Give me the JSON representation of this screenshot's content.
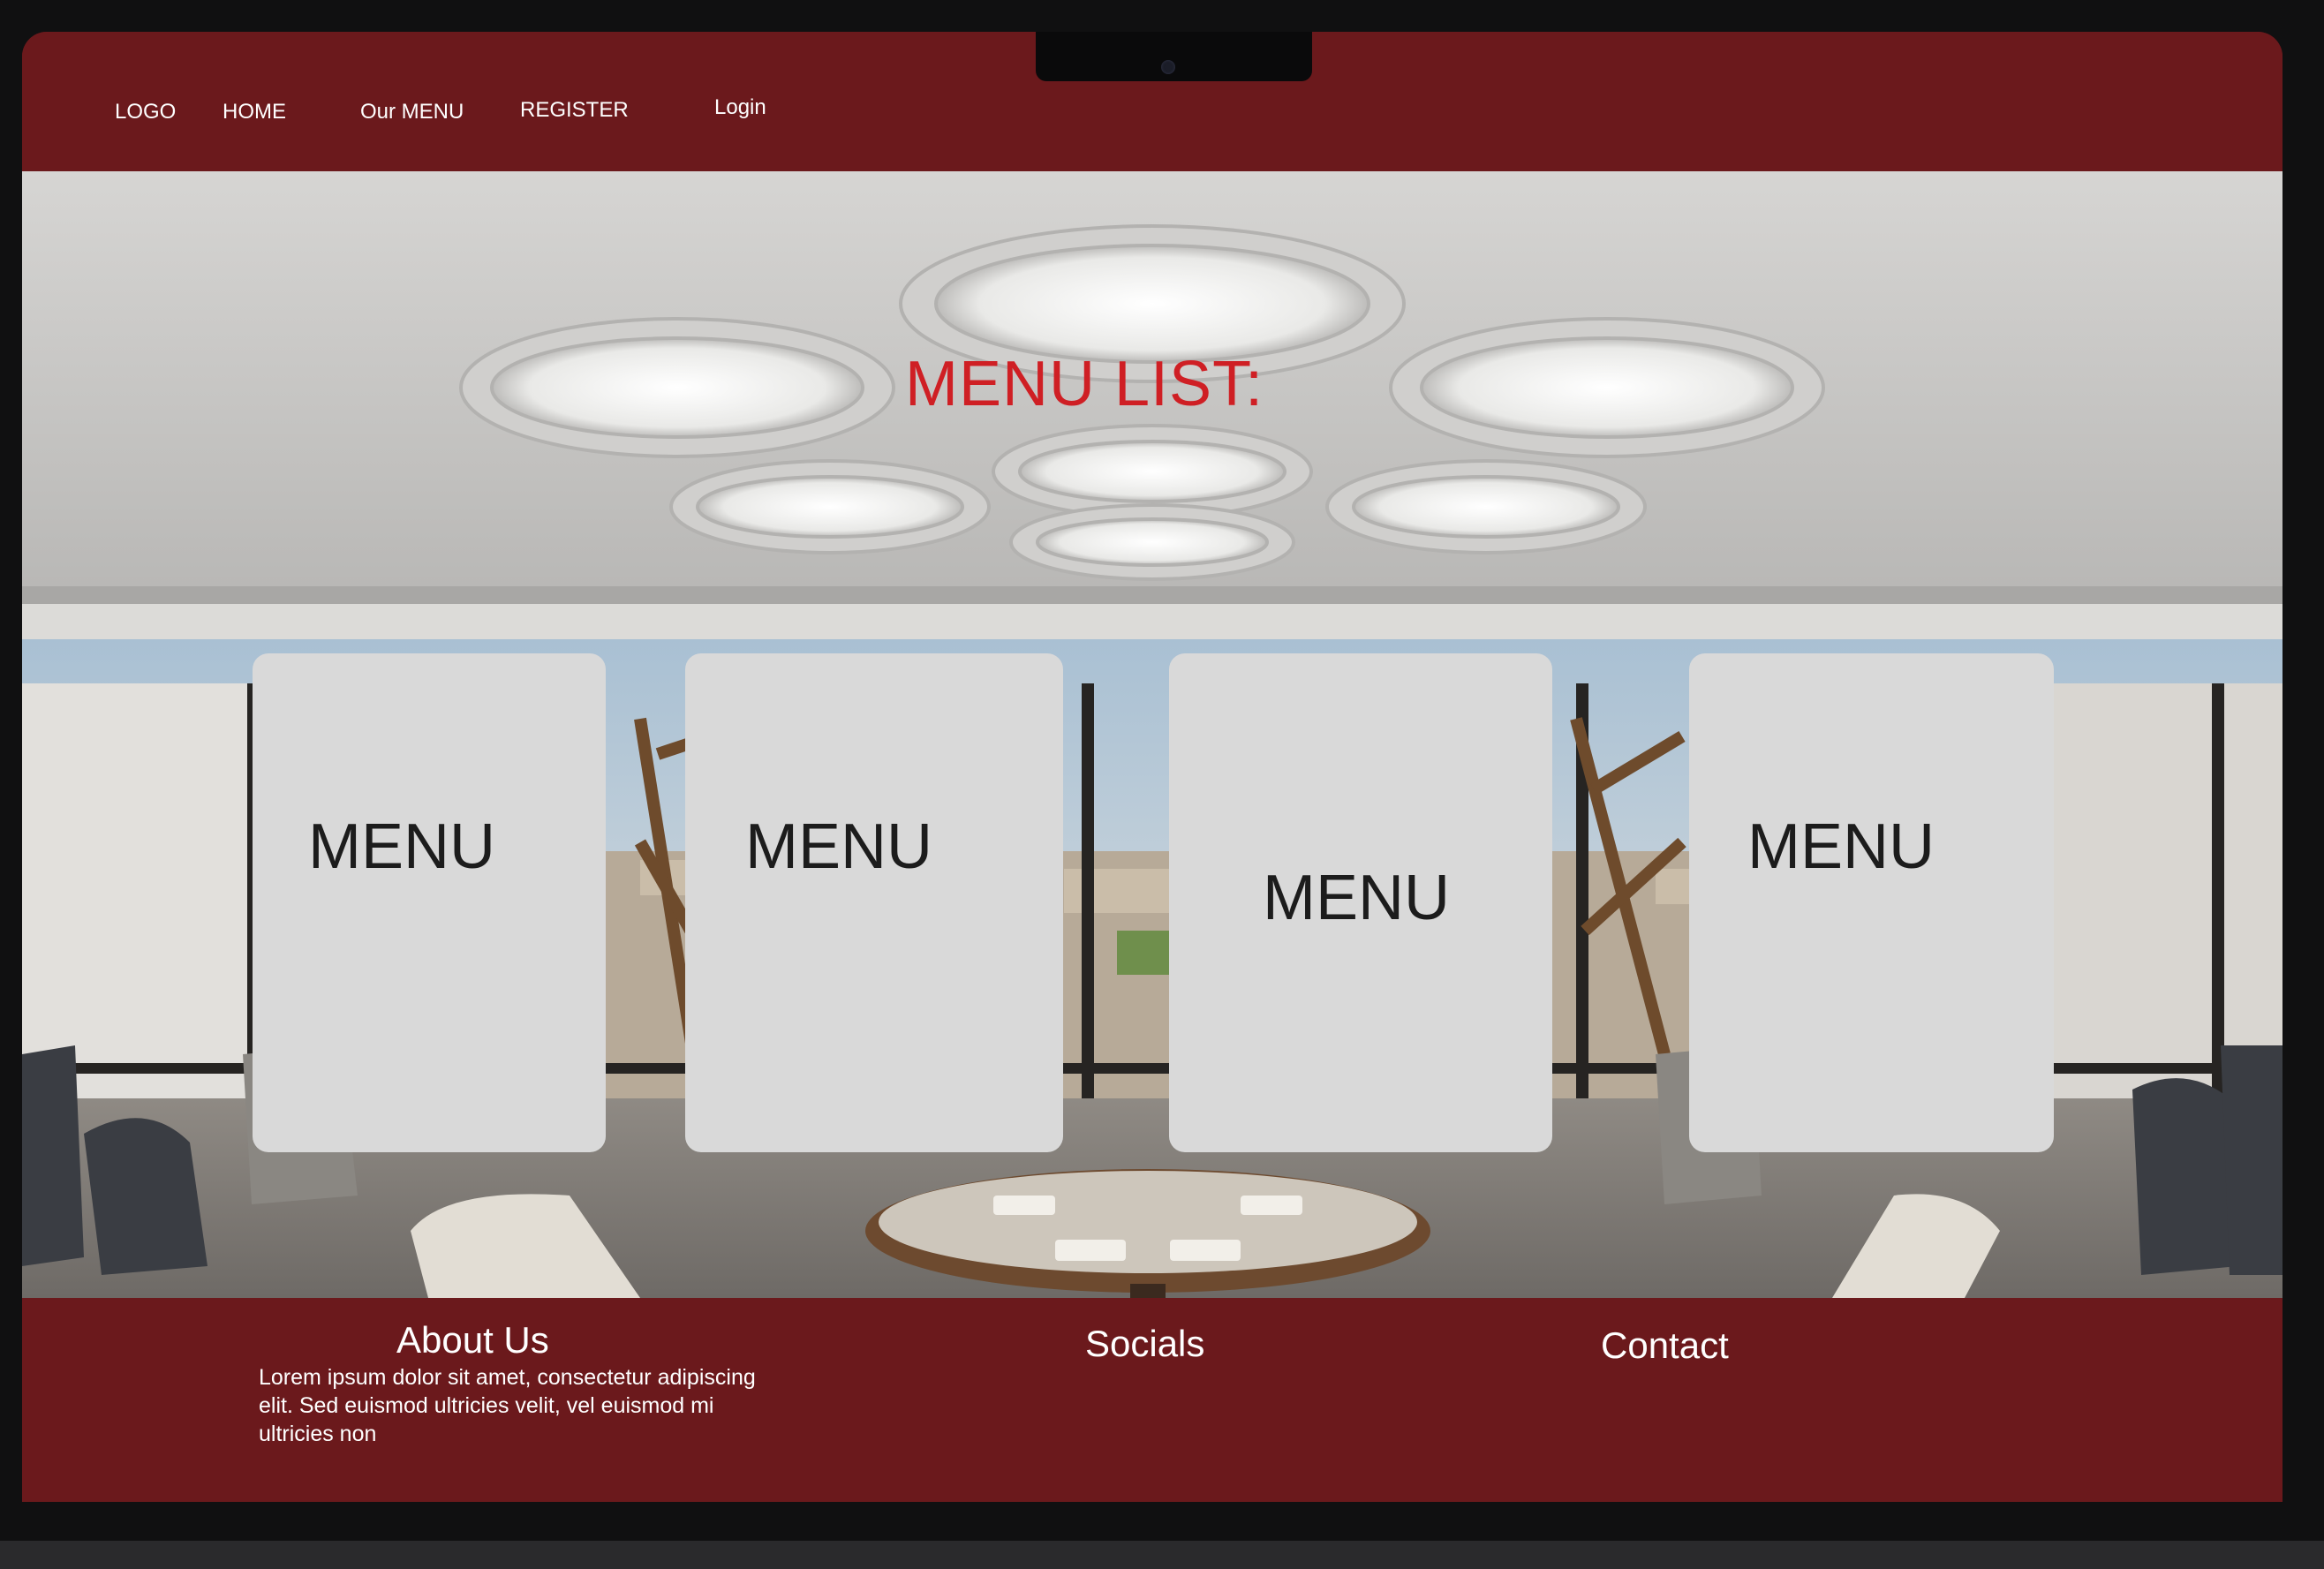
{
  "nav": {
    "logo": "LOGO",
    "home": "HOME",
    "menu": "Our MENU",
    "register": "REGISTER",
    "login": "Login"
  },
  "hero": {
    "title": "MENU LIST:",
    "cards": [
      {
        "label": "MENU"
      },
      {
        "label": "MENU"
      },
      {
        "label": "MENU"
      },
      {
        "label": "MENU"
      }
    ]
  },
  "footer": {
    "about_heading": "About Us",
    "about_text": "Lorem ipsum dolor sit amet, consectetur adipiscing elit. Sed euismod ultricies velit, vel euismod mi ultricies non",
    "socials_heading": "Socials",
    "contact_heading": "Contact"
  },
  "colors": {
    "brand": "#6b191c",
    "title_accent": "#cf1f24",
    "card": "#d9d9d9"
  }
}
